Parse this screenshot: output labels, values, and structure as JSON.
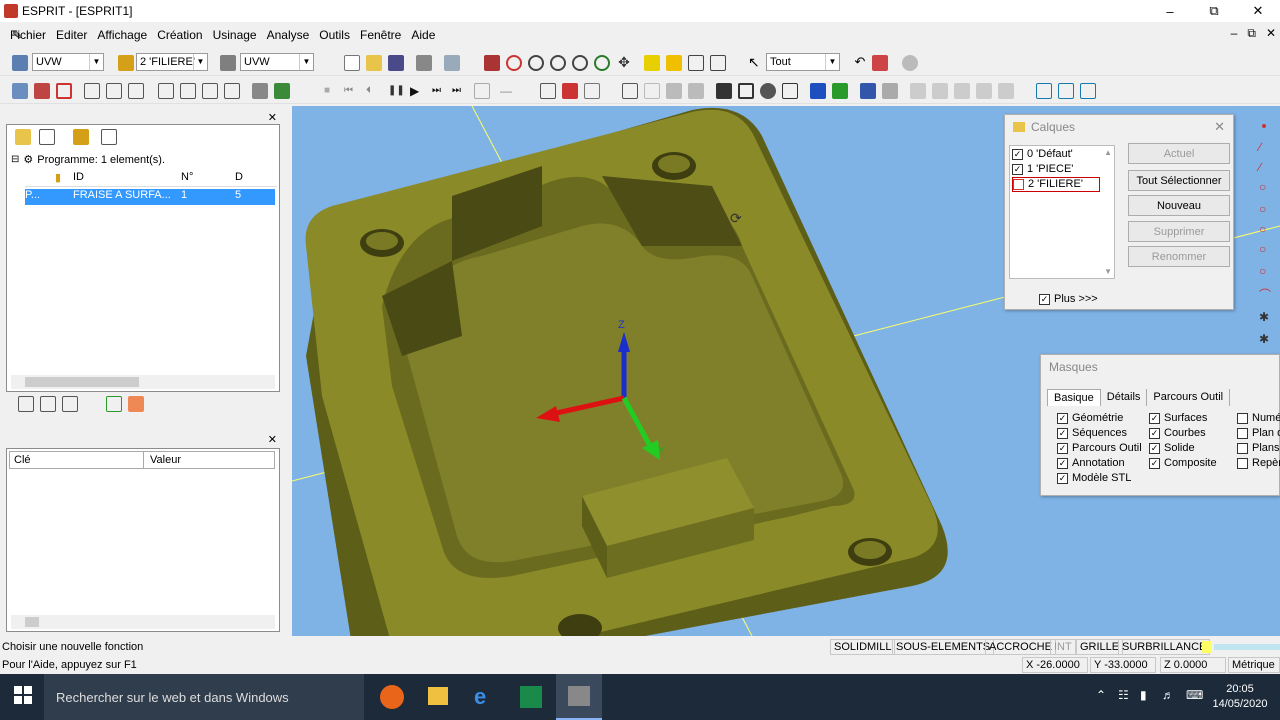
{
  "window": {
    "title": "ESPRIT - [ESPRIT1]"
  },
  "menu": [
    "Fichier",
    "Editer",
    "Affichage",
    "Création",
    "Usinage",
    "Analyse",
    "Outils",
    "Fenêtre",
    "Aide"
  ],
  "toolbar1": {
    "combo1": "UVW",
    "combo2": "2 'FILIERE'",
    "combo3": "UVW",
    "select_filter": "Tout"
  },
  "tree": {
    "root": "Programme: 1 element(s).",
    "columns": [
      "ID",
      "N°",
      "D"
    ],
    "row": {
      "col1": "P...",
      "id": "FRAISE A SURFA...",
      "num": "1",
      "d": "5"
    }
  },
  "props": {
    "columns": [
      "Clé",
      "Valeur"
    ]
  },
  "viewport": {
    "axis_z": "Z",
    "axis_y": "Y"
  },
  "calques": {
    "title": "Calques",
    "layers": [
      {
        "label": "0 'Défaut'",
        "checked": true
      },
      {
        "label": "1 'PIECE'",
        "checked": true
      },
      {
        "label": "2 'FILIERE'",
        "checked": false
      }
    ],
    "buttons": {
      "actuel": "Actuel",
      "tout": "Tout Sélectionner",
      "nouveau": "Nouveau",
      "supprimer": "Supprimer",
      "renommer": "Renommer"
    },
    "plus": "Plus >>>"
  },
  "masques": {
    "title": "Masques",
    "tabs": [
      "Basique",
      "Détails",
      "Parcours Outil"
    ],
    "col1": [
      "Géométrie",
      "Séquences",
      "Parcours Outil",
      "Annotation",
      "Modèle STL"
    ],
    "col2": [
      "Surfaces",
      "Courbes",
      "Solide",
      "Composite"
    ],
    "col3": [
      "Numé",
      "Plan d",
      "Plans",
      "Repèr"
    ]
  },
  "status": {
    "message": "Choisir une nouvelle fonction",
    "help": "Pour l'Aide, appuyez sur F1",
    "indicators": [
      "SOLIDMILL",
      "SOUS-ELEMENTS",
      "ACCROCHE",
      "INT",
      "GRILLE",
      "SURBRILLANCE"
    ],
    "x": "X -26.0000",
    "y": "Y -33.0000",
    "z": "Z 0.0000",
    "units": "Métrique"
  },
  "taskbar": {
    "search_placeholder": "Rechercher sur le web et dans Windows",
    "time": "20:05",
    "date": "14/05/2020"
  },
  "colors": {
    "viewport_bg": "#7fb3e6",
    "part": "#6b6b1f",
    "selection": "#3399ff"
  }
}
